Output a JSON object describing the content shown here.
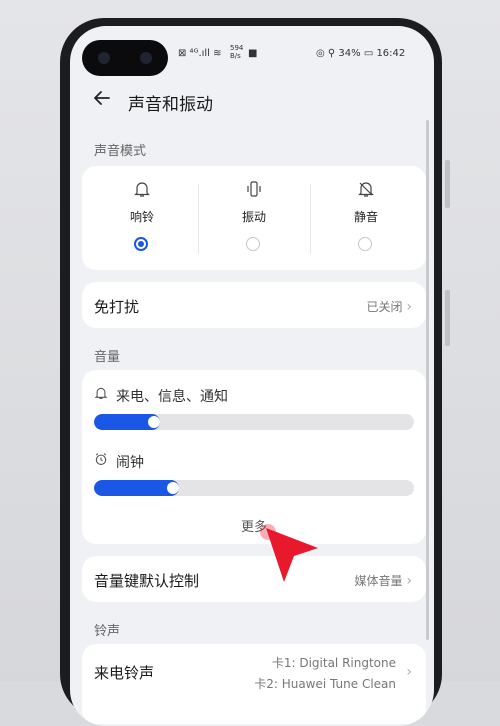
{
  "status": {
    "signal_left": "⊠ ⁴ᴳ.ıll ≋",
    "speed": "594\nB/s",
    "right": "◎ ⚲ 34% ▭ 16:42"
  },
  "header": {
    "back_icon": "arrow-left-icon",
    "title": "声音和振动"
  },
  "sound_mode": {
    "section_label": "声音模式",
    "modes": [
      {
        "label": "响铃",
        "icon": "bell-icon",
        "selected": true
      },
      {
        "label": "振动",
        "icon": "vibrate-icon",
        "selected": false
      },
      {
        "label": "静音",
        "icon": "bell-off-icon",
        "selected": false
      }
    ]
  },
  "dnd": {
    "label": "免打扰",
    "value": "已关闭",
    "chevron": "›"
  },
  "volume": {
    "section_label": "音量",
    "items": [
      {
        "label": "来电、信息、通知",
        "icon": "bell-icon",
        "level": 0.18
      },
      {
        "label": "闹钟",
        "icon": "alarm-clock-icon",
        "level": 0.24
      }
    ],
    "more_label": "更多"
  },
  "volume_key": {
    "label": "音量键默认控制",
    "value": "媒体音量",
    "chevron": "›"
  },
  "ringtone": {
    "section_label": "铃声",
    "label": "来电铃声",
    "value_line1": "卡1: Digital Ringtone",
    "value_line2": "卡2: Huawei Tune Clean",
    "chevron": "›"
  },
  "colors": {
    "accent": "#1a57e6",
    "pointer": "#e8192c"
  }
}
